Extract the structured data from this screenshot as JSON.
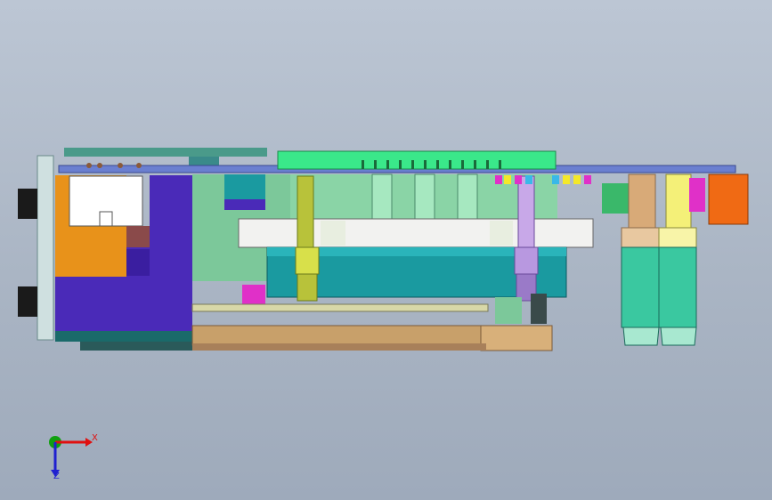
{
  "viewport": {
    "background_top": "#bcc6d4",
    "background_bottom": "#9eaabb"
  },
  "triad": {
    "x_label": "X",
    "z_label": "Z",
    "x_color": "#e01010",
    "z_color": "#2020d0",
    "y_color": "#10a010",
    "origin_icon": "axis-triad-icon"
  },
  "model": {
    "description_icon": "cad-assembly-side-view",
    "colors": {
      "pcb": "#6a7fd0",
      "base_plate": "#c8a06a",
      "purple_block": "#4a2ab8",
      "orange_block": "#e8921a",
      "green_body": "#7cc89a",
      "cyan_plate": "#1a9aa0",
      "white_plate": "#f2f2f0",
      "spring_left": "#b8c23a",
      "spring_right": "#9a7ac8",
      "connector_tan": "#d8aa78",
      "connector_yellow": "#f4f078",
      "orange_connector": "#f06a14",
      "magenta": "#e030c8"
    }
  }
}
